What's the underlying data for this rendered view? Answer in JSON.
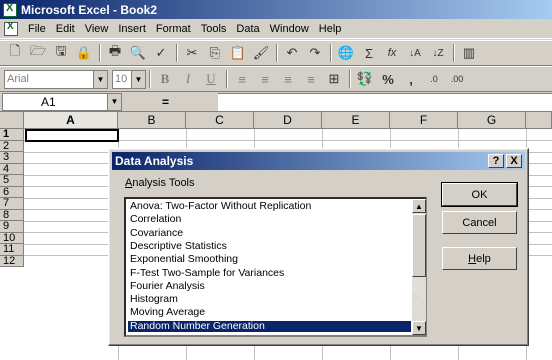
{
  "window": {
    "title": "Microsoft Excel - Book2"
  },
  "menu": {
    "items": [
      "File",
      "Edit",
      "View",
      "Insert",
      "Format",
      "Tools",
      "Data",
      "Window",
      "Help"
    ]
  },
  "standard_toolbar": {
    "buttons": [
      "new-icon",
      "open-icon",
      "save-icon",
      "permission-icon",
      "print-icon",
      "print-preview-icon",
      "spelling-icon",
      "cut-icon",
      "copy-icon",
      "paste-icon",
      "format-painter-icon",
      "undo-icon",
      "redo-icon",
      "hyperlink-icon",
      "autosum-icon",
      "function-icon",
      "sort-ascending-icon",
      "sort-descending-icon",
      "chart-wizard-icon"
    ],
    "glyphs": [
      "🗋",
      "🗁",
      "🖫",
      "🔒",
      "🖶",
      "🔍",
      "✓",
      "✂",
      "⎘",
      "📋",
      "🖌",
      "↶",
      "↷",
      "🌐",
      "Σ",
      "fx",
      "↓A",
      "↓Z",
      "▥"
    ]
  },
  "formatting_toolbar": {
    "font": "Arial",
    "size": "10",
    "bold": "B",
    "italic": "I",
    "underline": "U",
    "currency": "%",
    "comma": ",",
    "inc_decimal": ".0",
    "dec_decimal": ".00"
  },
  "formula_bar": {
    "name_box": "A1",
    "equals": "=",
    "value": ""
  },
  "grid": {
    "columns": [
      "A",
      "B",
      "C",
      "D",
      "E",
      "F",
      "G"
    ],
    "rows": [
      "1",
      "2",
      "3",
      "4",
      "5",
      "6",
      "7",
      "8",
      "9",
      "10",
      "11",
      "12"
    ],
    "active_column": "A",
    "active_row": "1"
  },
  "dialog": {
    "title": "Data Analysis",
    "help_btn": "?",
    "close_btn": "X",
    "label": "Analysis Tools",
    "label_accel": "A",
    "tools": [
      "Anova: Two-Factor Without Replication",
      "Correlation",
      "Covariance",
      "Descriptive Statistics",
      "Exponential Smoothing",
      "F-Test Two-Sample for Variances",
      "Fourier Analysis",
      "Histogram",
      "Moving Average",
      "Random Number Generation"
    ],
    "selected_index": 9,
    "ok": "OK",
    "cancel": "Cancel",
    "help": "Help"
  }
}
